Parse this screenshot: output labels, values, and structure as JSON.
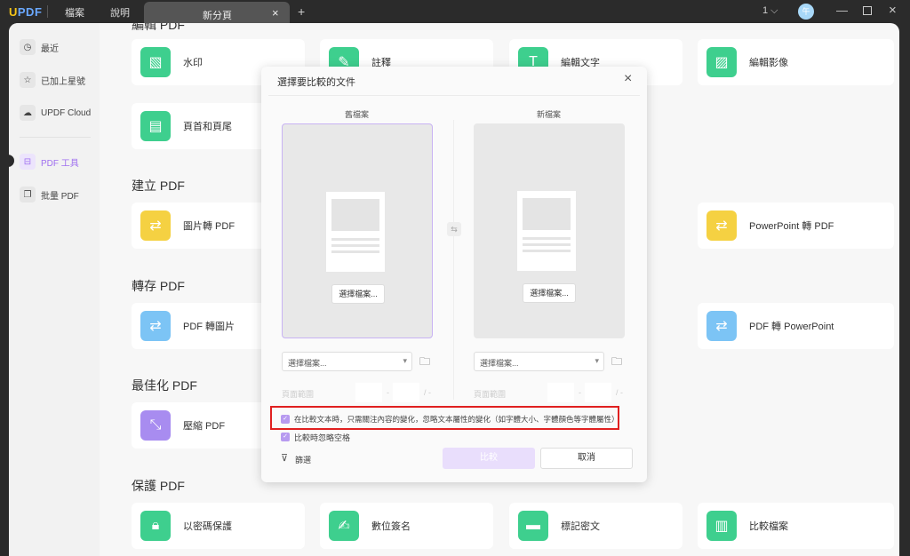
{
  "titlebar": {
    "logo": "UPDF",
    "menu": [
      "檔案",
      "說明"
    ],
    "tab": "新分頁",
    "tab_close": "×",
    "new_tab": "+",
    "page_count": "1",
    "user_initial": "午"
  },
  "sidebar": {
    "items": [
      {
        "label": "最近",
        "icon": "clock-icon"
      },
      {
        "label": "已加上星號",
        "icon": "star-icon"
      },
      {
        "label": "UPDF Cloud",
        "icon": "cloud-icon"
      },
      {
        "label": "PDF 工具",
        "icon": "toolbox-icon"
      },
      {
        "label": "批量 PDF",
        "icon": "batch-icon"
      }
    ]
  },
  "sections": {
    "edit": "編輯 PDF",
    "create": "建立 PDF",
    "export": "轉存 PDF",
    "optimize": "最佳化 PDF",
    "protect": "保護 PDF"
  },
  "tiles": {
    "watermark": "水印",
    "annotate": "註釋",
    "edit_text": "編輯文字",
    "edit_image": "編輯影像",
    "header_footer": "頁首和頁尾",
    "image_to_pdf": "圖片轉 PDF",
    "ppt_to_pdf": "PowerPoint 轉 PDF",
    "pdf_to_image": "PDF 轉圖片",
    "pdf_to_ppt": "PDF 轉 PowerPoint",
    "compress": "壓縮 PDF",
    "password": "以密碼保護",
    "signature": "數位簽名",
    "redact": "標記密文",
    "compare": "比較檔案"
  },
  "dialog": {
    "title": "選擇要比較的文件",
    "old_label": "舊檔案",
    "new_label": "新檔案",
    "select_button": "選擇檔案...",
    "dropdown_placeholder": "選擇檔案...",
    "page_range": "頁面範圍",
    "dash": "-",
    "slash": "/ -",
    "option1": "在比較文本時，只需關注內容的變化，忽略文本屬性的變化（如字體大小、字體顏色等字體屬性）",
    "option2": "比較時忽略空格",
    "filter": "篩選",
    "compare": "比較",
    "cancel": "取消"
  },
  "colors": {
    "accent": "#a88cf0",
    "green": "#3ecf8e",
    "highlight": "#e02020"
  }
}
